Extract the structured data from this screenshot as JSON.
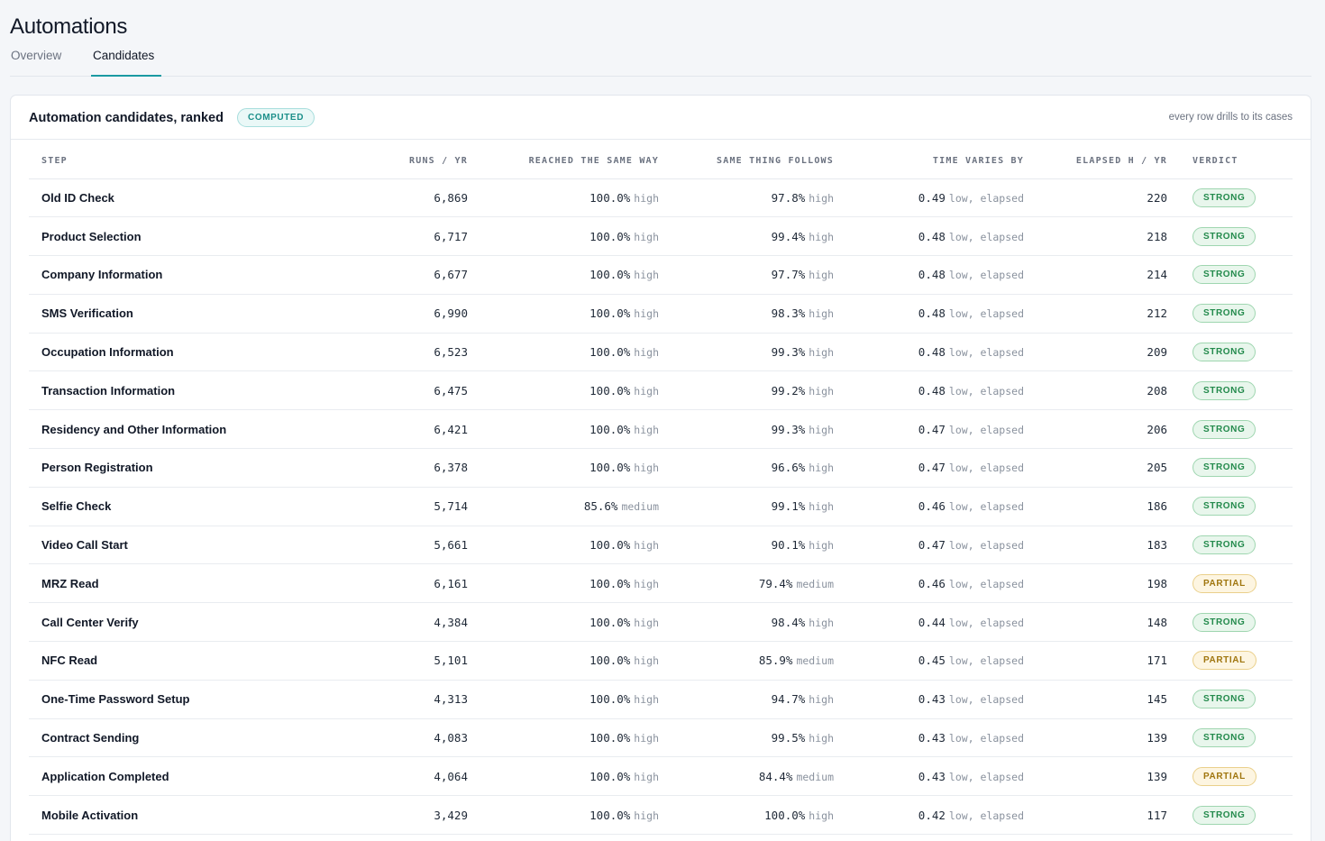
{
  "page": {
    "title": "Automations"
  },
  "tabs": [
    {
      "label": "Overview",
      "active": false
    },
    {
      "label": "Candidates",
      "active": true
    }
  ],
  "card": {
    "title": "Automation candidates, ranked",
    "badge": "COMPUTED",
    "note": "every row drills to its cases"
  },
  "columns": {
    "step": "STEP",
    "runs": "RUNS / YR",
    "reached": "REACHED THE SAME WAY",
    "follows": "SAME THING FOLLOWS",
    "varies": "TIME VARIES BY",
    "elapsed": "ELAPSED H / YR",
    "verdict": "VERDICT"
  },
  "colors": {
    "accent": "#1a9aa2",
    "strong": "#238a4c",
    "partial": "#a0760f"
  },
  "rows": [
    {
      "step": "Old ID Check",
      "runs": "6,869",
      "reached": "100.0%",
      "reached_q": "high",
      "follows": "97.8%",
      "follows_q": "high",
      "varies": "0.49",
      "varies_q": "low, elapsed",
      "elapsed": "220",
      "verdict": "STRONG"
    },
    {
      "step": "Product Selection",
      "runs": "6,717",
      "reached": "100.0%",
      "reached_q": "high",
      "follows": "99.4%",
      "follows_q": "high",
      "varies": "0.48",
      "varies_q": "low, elapsed",
      "elapsed": "218",
      "verdict": "STRONG"
    },
    {
      "step": "Company Information",
      "runs": "6,677",
      "reached": "100.0%",
      "reached_q": "high",
      "follows": "97.7%",
      "follows_q": "high",
      "varies": "0.48",
      "varies_q": "low, elapsed",
      "elapsed": "214",
      "verdict": "STRONG"
    },
    {
      "step": "SMS Verification",
      "runs": "6,990",
      "reached": "100.0%",
      "reached_q": "high",
      "follows": "98.3%",
      "follows_q": "high",
      "varies": "0.48",
      "varies_q": "low, elapsed",
      "elapsed": "212",
      "verdict": "STRONG"
    },
    {
      "step": "Occupation Information",
      "runs": "6,523",
      "reached": "100.0%",
      "reached_q": "high",
      "follows": "99.3%",
      "follows_q": "high",
      "varies": "0.48",
      "varies_q": "low, elapsed",
      "elapsed": "209",
      "verdict": "STRONG"
    },
    {
      "step": "Transaction Information",
      "runs": "6,475",
      "reached": "100.0%",
      "reached_q": "high",
      "follows": "99.2%",
      "follows_q": "high",
      "varies": "0.48",
      "varies_q": "low, elapsed",
      "elapsed": "208",
      "verdict": "STRONG"
    },
    {
      "step": "Residency and Other Information",
      "runs": "6,421",
      "reached": "100.0%",
      "reached_q": "high",
      "follows": "99.3%",
      "follows_q": "high",
      "varies": "0.47",
      "varies_q": "low, elapsed",
      "elapsed": "206",
      "verdict": "STRONG"
    },
    {
      "step": "Person Registration",
      "runs": "6,378",
      "reached": "100.0%",
      "reached_q": "high",
      "follows": "96.6%",
      "follows_q": "high",
      "varies": "0.47",
      "varies_q": "low, elapsed",
      "elapsed": "205",
      "verdict": "STRONG"
    },
    {
      "step": "Selfie Check",
      "runs": "5,714",
      "reached": "85.6%",
      "reached_q": "medium",
      "follows": "99.1%",
      "follows_q": "high",
      "varies": "0.46",
      "varies_q": "low, elapsed",
      "elapsed": "186",
      "verdict": "STRONG"
    },
    {
      "step": "Video Call Start",
      "runs": "5,661",
      "reached": "100.0%",
      "reached_q": "high",
      "follows": "90.1%",
      "follows_q": "high",
      "varies": "0.47",
      "varies_q": "low, elapsed",
      "elapsed": "183",
      "verdict": "STRONG"
    },
    {
      "step": "MRZ Read",
      "runs": "6,161",
      "reached": "100.0%",
      "reached_q": "high",
      "follows": "79.4%",
      "follows_q": "medium",
      "varies": "0.46",
      "varies_q": "low, elapsed",
      "elapsed": "198",
      "verdict": "PARTIAL"
    },
    {
      "step": "Call Center Verify",
      "runs": "4,384",
      "reached": "100.0%",
      "reached_q": "high",
      "follows": "98.4%",
      "follows_q": "high",
      "varies": "0.44",
      "varies_q": "low, elapsed",
      "elapsed": "148",
      "verdict": "STRONG"
    },
    {
      "step": "NFC Read",
      "runs": "5,101",
      "reached": "100.0%",
      "reached_q": "high",
      "follows": "85.9%",
      "follows_q": "medium",
      "varies": "0.45",
      "varies_q": "low, elapsed",
      "elapsed": "171",
      "verdict": "PARTIAL"
    },
    {
      "step": "One-Time Password Setup",
      "runs": "4,313",
      "reached": "100.0%",
      "reached_q": "high",
      "follows": "94.7%",
      "follows_q": "high",
      "varies": "0.43",
      "varies_q": "low, elapsed",
      "elapsed": "145",
      "verdict": "STRONG"
    },
    {
      "step": "Contract Sending",
      "runs": "4,083",
      "reached": "100.0%",
      "reached_q": "high",
      "follows": "99.5%",
      "follows_q": "high",
      "varies": "0.43",
      "varies_q": "low, elapsed",
      "elapsed": "139",
      "verdict": "STRONG"
    },
    {
      "step": "Application Completed",
      "runs": "4,064",
      "reached": "100.0%",
      "reached_q": "high",
      "follows": "84.4%",
      "follows_q": "medium",
      "varies": "0.43",
      "varies_q": "low, elapsed",
      "elapsed": "139",
      "verdict": "PARTIAL"
    },
    {
      "step": "Mobile Activation",
      "runs": "3,429",
      "reached": "100.0%",
      "reached_q": "high",
      "follows": "100.0%",
      "follows_q": "high",
      "varies": "0.42",
      "varies_q": "low, elapsed",
      "elapsed": "117",
      "verdict": "STRONG"
    }
  ]
}
